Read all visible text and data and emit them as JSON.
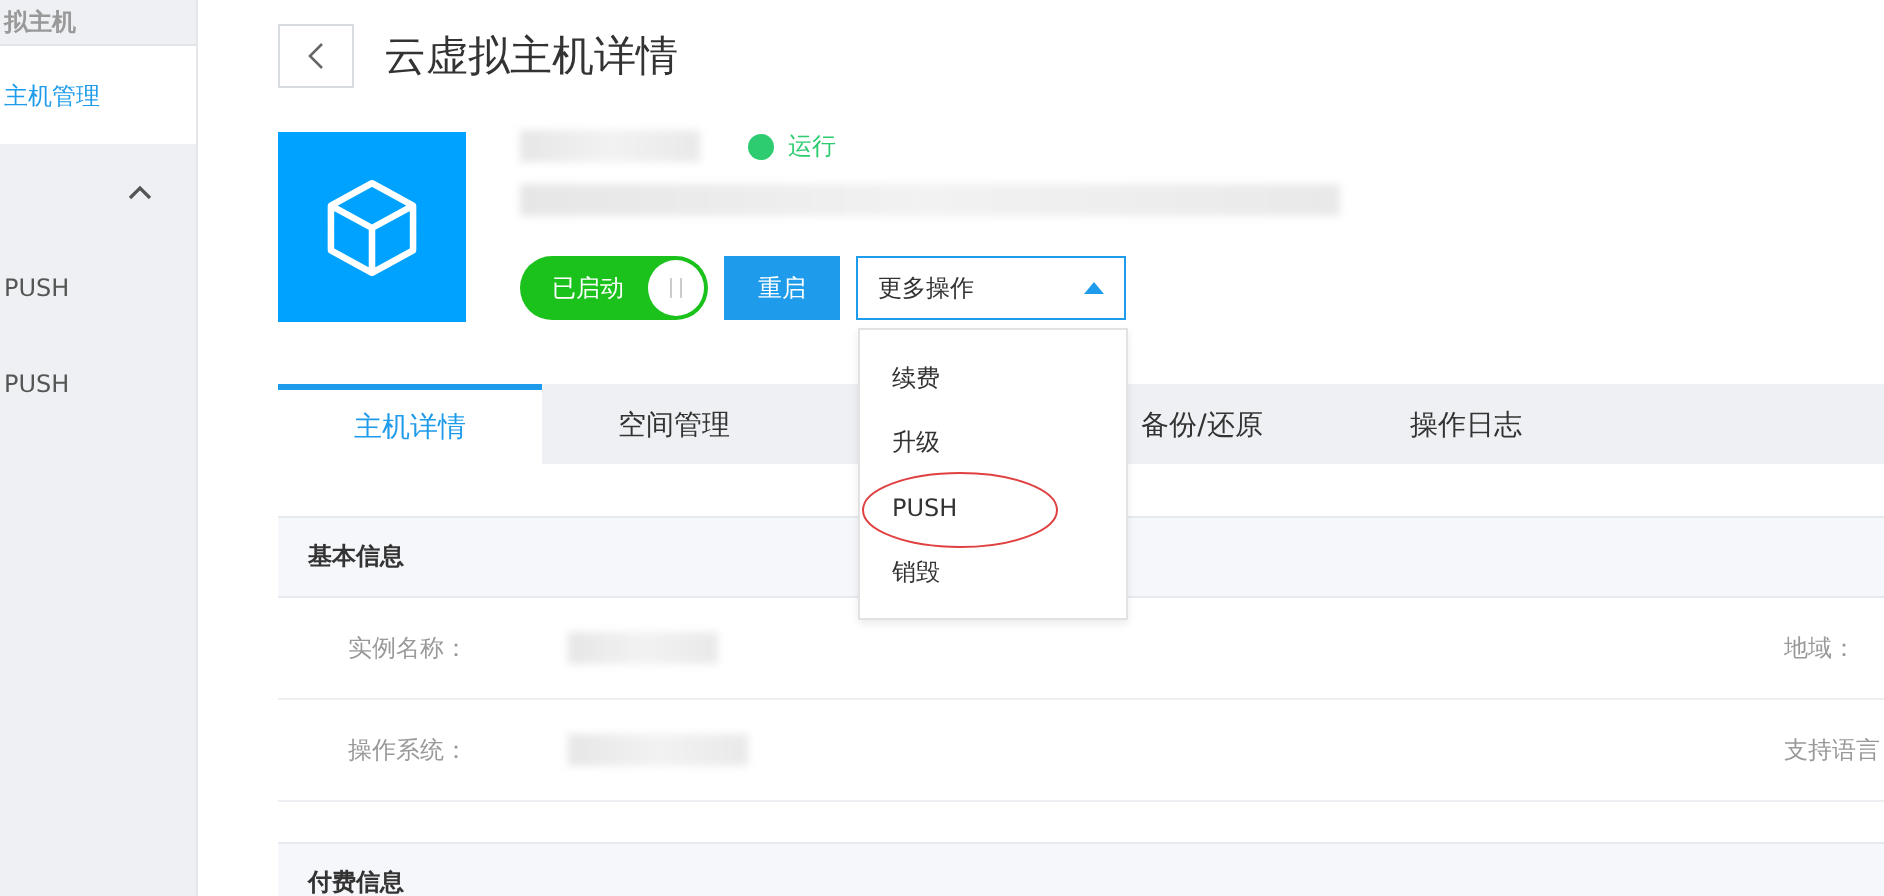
{
  "sidebar": {
    "heading": "拟主机",
    "group_expanded": true,
    "items": [
      {
        "label": "主机管理",
        "selected": true
      },
      {
        "label": "PUSH",
        "selected": false
      },
      {
        "label": "PUSH",
        "selected": false
      }
    ]
  },
  "page": {
    "title": "云虚拟主机详情"
  },
  "host": {
    "status": {
      "label": "运行",
      "kind": "running"
    },
    "power": {
      "label": "已启动",
      "on": true
    },
    "restart": "重启",
    "more": {
      "label": "更多操作",
      "expanded": true,
      "options": [
        {
          "label": "续费",
          "highlighted": false
        },
        {
          "label": "升级",
          "highlighted": false
        },
        {
          "label": "PUSH",
          "highlighted": true
        },
        {
          "label": "销毁",
          "highlighted": false
        }
      ]
    }
  },
  "tabs": [
    {
      "label": "主机详情",
      "selected": true
    },
    {
      "label": "空间管理",
      "selected": false
    },
    {
      "label": "备份/还原",
      "selected": false
    },
    {
      "label": "操作日志",
      "selected": false
    }
  ],
  "basic": {
    "title": "基本信息",
    "rows": [
      {
        "label": "实例名称：",
        "right_label": "地域："
      },
      {
        "label": "操作系统：",
        "right_label": "支持语言"
      }
    ]
  },
  "billing": {
    "title": "付费信息"
  }
}
